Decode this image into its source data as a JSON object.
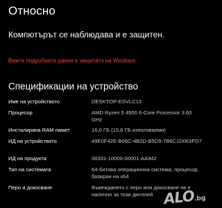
{
  "page": {
    "title": "Относно",
    "protection_status": "Компютърът се наблюдава и е защитен.",
    "security_link": "Вижте подробните данни в защитата на Windows"
  },
  "colors": {
    "background": "#000000",
    "accent": "#ff3b3b",
    "text": "#ffffff",
    "secondary_text": "#c8c8c8"
  },
  "device_specs": {
    "heading": "Спецификации на устройство",
    "rows": [
      {
        "label": "Име на устройството",
        "value": "DESKTOP-ESVLC13"
      },
      {
        "label": "Процесор",
        "value": "AMD Ryzen 5 4500 6-Core Processor 3.60 GHz"
      },
      {
        "label": "Инсталирана RAM памет",
        "value": "16,0 ГБ (15,8 ГБ използваеми)"
      },
      {
        "label": "ИД на устройството",
        "value": "49E0F42E-B06C-4B2D-B5D9-7B6C1D063FD7"
      },
      {
        "label": "ИД на продукта",
        "value": "00331-10000-00001-AA942"
      },
      {
        "label": "Тип на системата",
        "value": "64-битова операционна система, процесор, базиран на x64"
      },
      {
        "label": "Перо и докосване",
        "value": "Въвеждането с перо или докосване не е налично за този дисплей"
      }
    ]
  },
  "watermark": {
    "brand": "ALO",
    "tld": ".bg"
  }
}
